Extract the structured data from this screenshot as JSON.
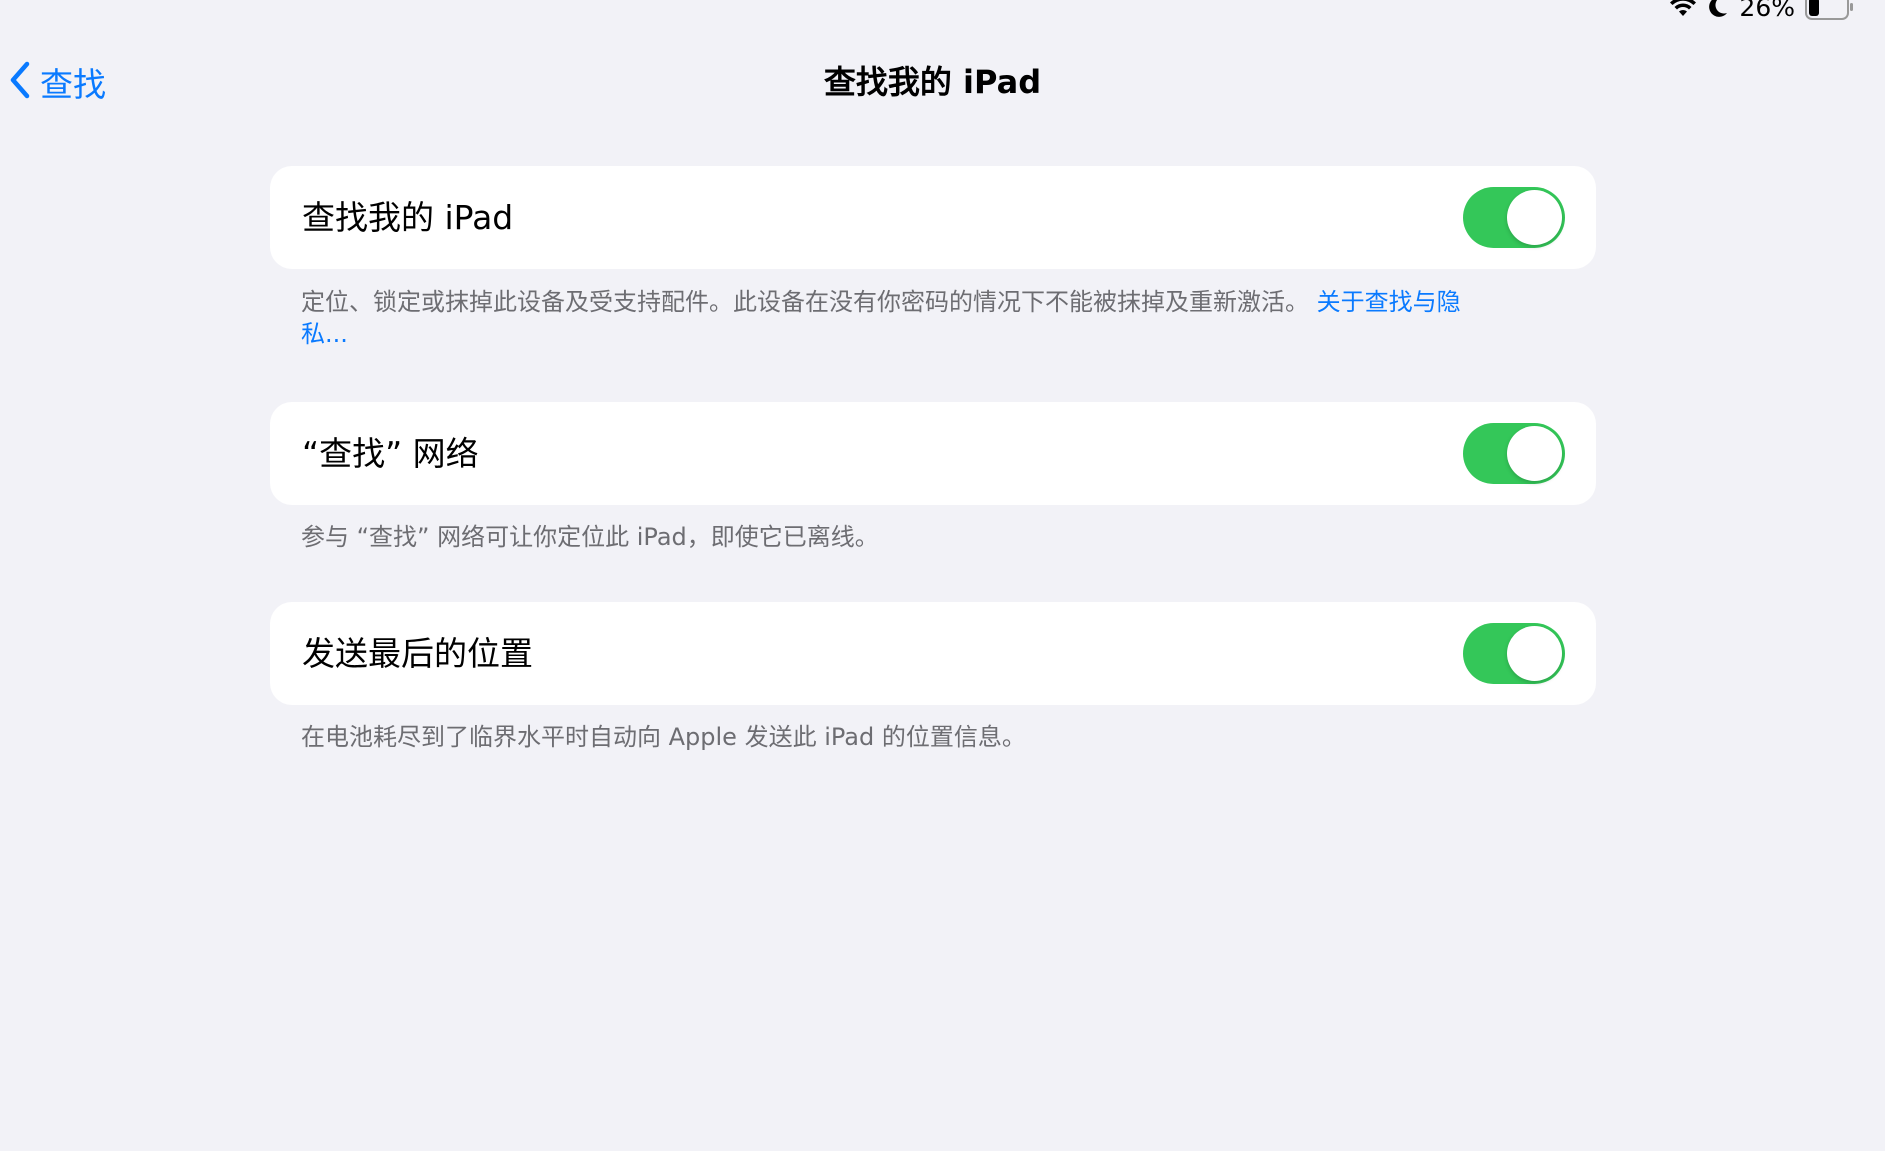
{
  "status_bar": {
    "wifi_icon": "wifi-icon",
    "focus_icon": "moon-icon",
    "battery_percent": "26%",
    "battery_icon": "battery-icon"
  },
  "nav": {
    "back_label": "查找",
    "title": "查找我的 iPad"
  },
  "sections": [
    {
      "label": "查找我的 iPad",
      "toggle_on": true,
      "footer_text": "定位、锁定或抹掉此设备及受支持配件。此设备在没有你密码的情况下不能被抹掉及重新激活。",
      "footer_link": "关于查找与隐私..."
    },
    {
      "label": "“查找” 网络",
      "toggle_on": true,
      "footer_text": "参与 “查找” 网络可让你定位此 iPad，即使它已离线。"
    },
    {
      "label": "发送最后的位置",
      "toggle_on": true,
      "footer_text": "在电池耗尽到了临界水平时自动向 Apple 发送此 iPad 的位置信息。"
    }
  ],
  "colors": {
    "background": "#f2f2f7",
    "accent": "#0a7aff",
    "toggle_on": "#34c759",
    "footer_text": "#6d6d72"
  }
}
